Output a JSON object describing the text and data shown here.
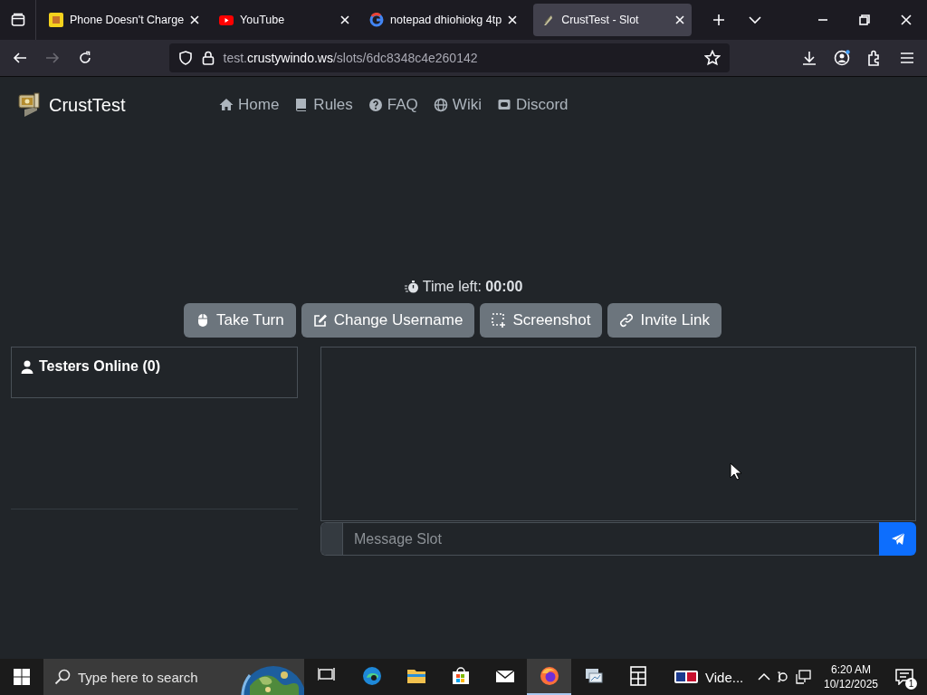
{
  "browser": {
    "tabs": [
      {
        "kind": "yellow",
        "title": "Phone Doesn't Charge",
        "selected": false
      },
      {
        "kind": "video",
        "title": "YouTube",
        "selected": false
      },
      {
        "kind": "google",
        "title": "notepad dhiohiokg 4tp",
        "selected": false
      },
      {
        "kind": "leaf",
        "title": "CrustTest - Slot",
        "selected": true
      }
    ],
    "nav_buttons": [
      {
        "kind": "back",
        "disabled": false
      },
      {
        "kind": "forward",
        "disabled": true
      },
      {
        "kind": "reload",
        "disabled": false
      }
    ],
    "address": {
      "host_prefix": "test.",
      "domain": "crustywindo.ws",
      "path": "/slots/6dc8348c4e260142"
    }
  },
  "site": {
    "brand": "CrustTest",
    "nav": [
      {
        "kind": "home",
        "label": "Home"
      },
      {
        "kind": "book",
        "label": "Rules"
      },
      {
        "kind": "question",
        "label": "FAQ"
      },
      {
        "kind": "globe",
        "label": "Wiki"
      },
      {
        "kind": "chat",
        "label": "Discord"
      }
    ],
    "timer": {
      "label": "Time left:",
      "value": "00:00"
    },
    "actions": [
      {
        "kind": "mouse",
        "label": "Take Turn"
      },
      {
        "kind": "edit",
        "label": "Change Username"
      },
      {
        "kind": "select",
        "label": "Screenshot"
      },
      {
        "kind": "link",
        "label": "Invite Link"
      }
    ],
    "testers": {
      "title": "Testers Online (0)"
    },
    "chat": {
      "placeholder": "Message Slot"
    }
  },
  "taskbar": {
    "search_placeholder": "Type here to search",
    "apps": [
      {
        "kind": "taskview",
        "selected": false
      },
      {
        "kind": "edge",
        "selected": false
      },
      {
        "kind": "folder",
        "selected": false
      },
      {
        "kind": "store",
        "selected": false
      },
      {
        "kind": "mail",
        "selected": false
      },
      {
        "kind": "firefox",
        "selected": true
      },
      {
        "kind": "remote",
        "selected": false
      },
      {
        "kind": "calc",
        "selected": false
      }
    ],
    "media_app": {
      "label": "Vide..."
    },
    "clock": {
      "time": "6:20 AM",
      "date": "10/12/2025"
    },
    "notifications": {
      "count": "1"
    }
  }
}
